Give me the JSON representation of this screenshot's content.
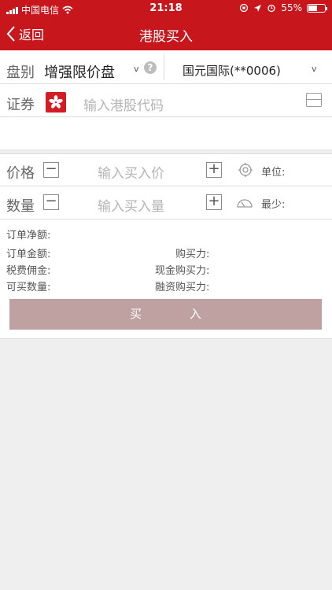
{
  "status_bar": {
    "carrier": "中国电信",
    "time": "21:18",
    "battery": "55%",
    "battery_level": 0.55
  },
  "nav": {
    "back_label": "返回",
    "title": "港股买入"
  },
  "form": {
    "board_label": "盘别",
    "board_value": "增强限价盘",
    "board_caret": "v",
    "help_glyph": "?",
    "account_value": "国元国际(**0006)",
    "account_caret": "v",
    "security_label": "证券",
    "security_placeholder": "输入港股代码",
    "price_label": "价格",
    "price_placeholder": "输入买入价",
    "unit_label": "单位:",
    "qty_label": "数量",
    "qty_placeholder": "输入买入量",
    "min_label": "最少:",
    "minus_glyph": "−",
    "plus_glyph": "+"
  },
  "summary": {
    "net_amount_label": "订单净额:",
    "order_amount_label": "订单金额:",
    "purchasing_power_label": "购买力:",
    "fee_label": "税费佣金:",
    "cash_power_label": "现金购买力:",
    "buyable_qty_label": "可买数量:",
    "margin_power_label": "融资购买力:"
  },
  "action": {
    "buy_label": "买 入"
  },
  "colors": {
    "brand": "#c8161d",
    "button_disabled": "#c0a1a1"
  }
}
